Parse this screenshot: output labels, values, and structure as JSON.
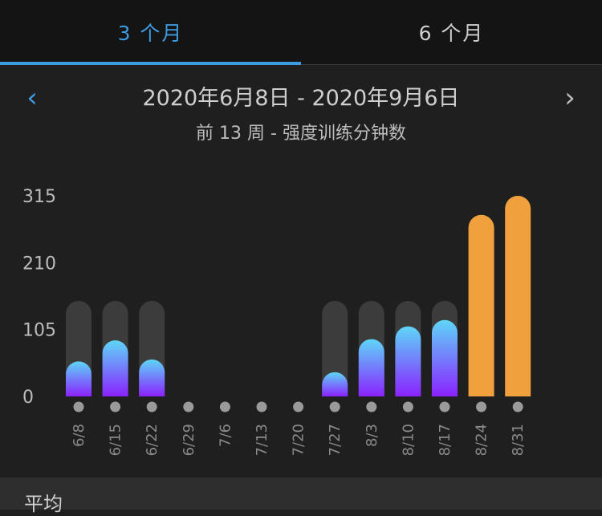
{
  "tabs": [
    {
      "label": "3 个月",
      "active": true
    },
    {
      "label": "6 个月",
      "active": false
    }
  ],
  "header": {
    "prev_icon": "chevron-left-icon",
    "next_icon": "chevron-right-icon",
    "date_range": "2020年6月8日 - 2020年9月6日",
    "subtitle": "前 13 周 - 强度训练分钟数"
  },
  "footer": {
    "label": "平均"
  },
  "colors": {
    "accent": "#3d9be0",
    "bar_gradient_top": "#5ed6f7",
    "bar_gradient_bottom": "#8a22ff",
    "goal_track": "#3c3c3c",
    "exceed": "#f0a03c",
    "dot": "#9a9a9a"
  },
  "chart_data": {
    "type": "bar",
    "categories": [
      "6/8",
      "6/15",
      "6/22",
      "6/29",
      "7/6",
      "7/13",
      "7/20",
      "7/27",
      "8/3",
      "8/10",
      "8/17",
      "8/24",
      "8/31"
    ],
    "values": [
      55,
      88,
      58,
      0,
      0,
      0,
      0,
      38,
      90,
      110,
      120,
      285,
      315
    ],
    "goal": 150,
    "exceeded": [
      false,
      false,
      false,
      false,
      false,
      false,
      false,
      false,
      false,
      false,
      false,
      true,
      true
    ],
    "yticks": [
      0,
      105,
      210,
      315
    ],
    "ylim": [
      0,
      315
    ],
    "grid": false
  }
}
